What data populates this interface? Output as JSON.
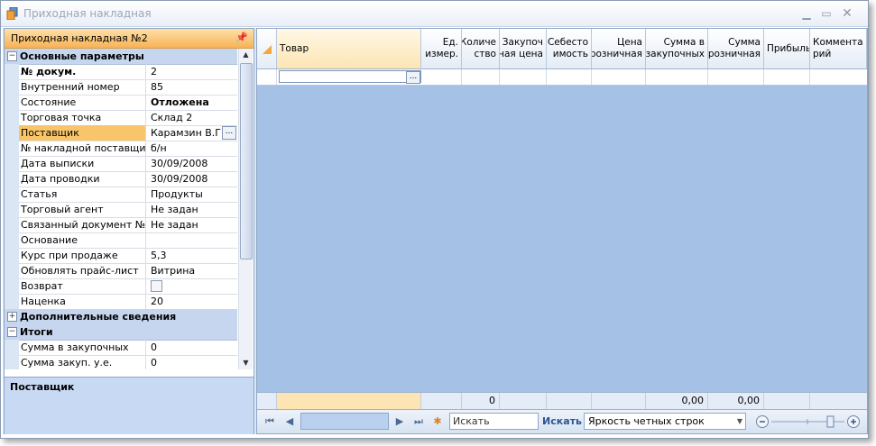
{
  "window": {
    "title": "Приходная накладная",
    "controls": [
      "minimize",
      "maximize",
      "close"
    ]
  },
  "left_panel": {
    "header": "Приходная накладная №2",
    "categories": {
      "main": "Основные параметры",
      "extra": "Дополнительные сведения",
      "totals": "Итоги"
    },
    "rows": [
      {
        "name": "№ докум.",
        "value": "2",
        "bold_name": true
      },
      {
        "name": "Внутренний номер",
        "value": "85"
      },
      {
        "name": "Состояние",
        "value": "Отложена",
        "bold_value": true
      },
      {
        "name": "Торговая точка",
        "value": "Склад 2"
      },
      {
        "name": "Поставщик",
        "value": "Карамзин В.Г.",
        "selected": true
      },
      {
        "name": "№ накладной поставщика",
        "value": "б/н"
      },
      {
        "name": "Дата выписки",
        "value": "30/09/2008"
      },
      {
        "name": "Дата проводки",
        "value": "30/09/2008"
      },
      {
        "name": "Статья",
        "value": "Продукты"
      },
      {
        "name": "Торговый агент",
        "value": "Не задан"
      },
      {
        "name": "Связанный документ №",
        "value": "Не задан"
      },
      {
        "name": "Основание",
        "value": ""
      },
      {
        "name": "Курс при продаже",
        "value": "5,3"
      },
      {
        "name": "Обновлять прайс-лист",
        "value": "Витрина"
      },
      {
        "name": "Возврат",
        "value": "",
        "checkbox": true,
        "checked": false
      },
      {
        "name": "Наценка",
        "value": "20"
      }
    ],
    "totals_rows": [
      {
        "name": "Сумма в закупочных",
        "value": "0"
      },
      {
        "name": "Сумма закуп. у.е.",
        "value": "0"
      }
    ],
    "ellipsis": "...",
    "description_title": "Поставщик"
  },
  "grid": {
    "columns": [
      {
        "label": "Товар",
        "align": "left"
      },
      {
        "label": "Ед.\nизмер.",
        "align": "right"
      },
      {
        "label": "Количе\nство",
        "align": "right"
      },
      {
        "label": "Закупоч\nная цена",
        "align": "right"
      },
      {
        "label": "Себесто\nимость",
        "align": "right"
      },
      {
        "label": "Цена\nрозничная",
        "align": "right"
      },
      {
        "label": "Сумма в\nзакупочных",
        "align": "right"
      },
      {
        "label": "Сумма\nрозничная",
        "align": "right"
      },
      {
        "label": "Прибыль",
        "align": "left"
      },
      {
        "label": "Коммента\nрий",
        "align": "left"
      }
    ],
    "new_row_button": "...",
    "footer": {
      "quantity_total": "0",
      "purchase_sum_total": "0,00",
      "retail_sum_total": "0,00"
    },
    "navigator": {
      "search_placeholder": "Искать",
      "search_button": "Искать",
      "row_style_combo": "Яркость четных строк"
    }
  },
  "colors": {
    "accent_orange": "#f8b257",
    "grid_background": "#a5c1e6",
    "category_background": "#c6d6ee"
  }
}
